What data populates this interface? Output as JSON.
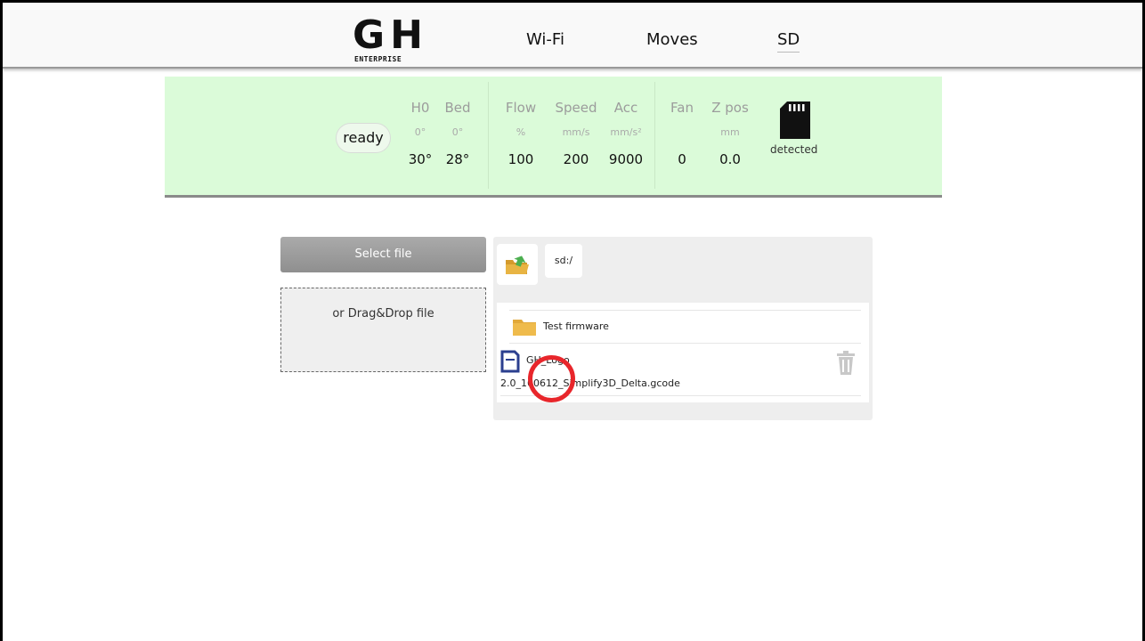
{
  "header": {
    "logo_main": "GH",
    "logo_sub": "ENTERPRISE",
    "nav": [
      {
        "label": "Wi-Fi"
      },
      {
        "label": "Moves"
      },
      {
        "label": "SD",
        "active": true
      }
    ]
  },
  "status": {
    "state": "ready",
    "h0": {
      "label": "H0",
      "target": "0°",
      "current": "30°"
    },
    "bed": {
      "label": "Bed",
      "target": "0°",
      "current": "28°"
    },
    "flow": {
      "label": "Flow",
      "unit": "%",
      "value": "100"
    },
    "speed": {
      "label": "Speed",
      "unit": "mm/s",
      "value": "200"
    },
    "acc": {
      "label": "Acc",
      "unit": "mm/s²",
      "value": "9000"
    },
    "fan": {
      "label": "Fan",
      "value": "0"
    },
    "zpos": {
      "label": "Z pos",
      "unit": "mm",
      "value": "0.0"
    },
    "sd": {
      "icon": "sd-card-icon",
      "text": "detected"
    }
  },
  "upload": {
    "select_label": "Select file",
    "drop_label": "or Drag&Drop file"
  },
  "browser": {
    "path": "sd:/",
    "items": [
      {
        "type": "folder",
        "name": "Test firmware",
        "icon": "folder-icon"
      },
      {
        "type": "file",
        "name_line1": "GH_Logo",
        "name_line2": "2.0_160612_Simplify3D_Delta.gcode",
        "icon": "file-icon"
      }
    ]
  },
  "colors": {
    "status_bg": "#dbfbd9",
    "folder": "#e2a93a",
    "cursor_ring": "#e8262b"
  }
}
